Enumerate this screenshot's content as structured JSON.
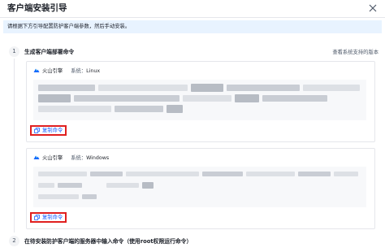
{
  "modal": {
    "title": "客户端安装引导",
    "close_icon": "close-icon"
  },
  "tip": {
    "text": "请根据下方引导配置防护客户端参数，然后手动安装。"
  },
  "steps": [
    {
      "number": "1",
      "title": "生成客户端部署命令"
    },
    {
      "number": "2",
      "title": "在待安装防护客户端的服务器中输入命令（使用root权限运行命令）"
    }
  ],
  "view_supported_link": "查看系统支持的版本",
  "cards": [
    {
      "brand": "火山引擎",
      "system_label": "系统：",
      "system_value": "Linux",
      "copy_label": "复制命令"
    },
    {
      "brand": "火山引擎",
      "system_label": "系统：",
      "system_value": "Windows",
      "copy_label": "复制命令"
    }
  ],
  "colors": {
    "accent": "#165dff",
    "highlight_border": "#e02020",
    "tip_background": "#e8f3ff"
  }
}
